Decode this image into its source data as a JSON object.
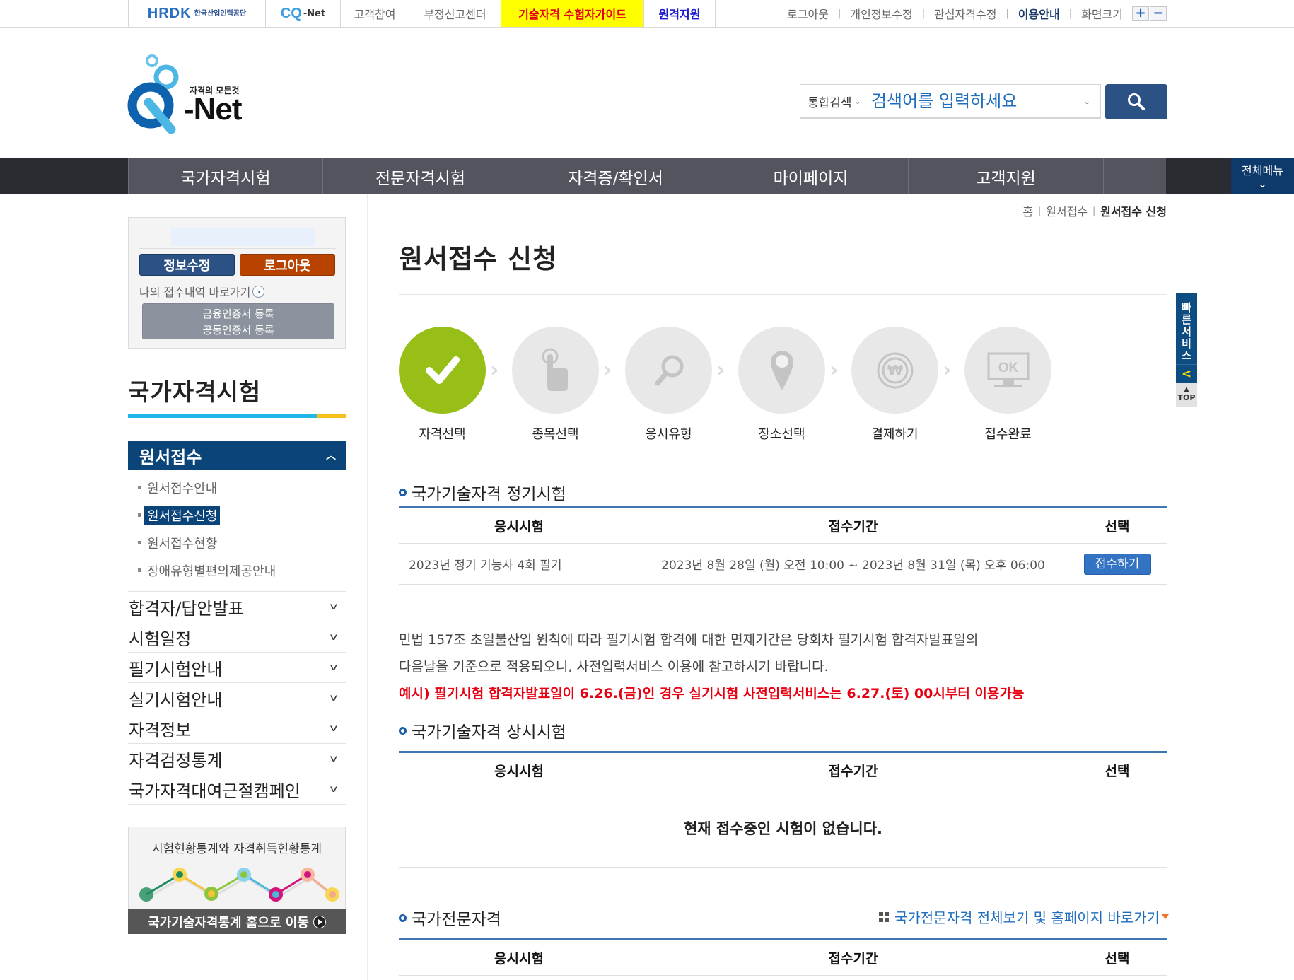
{
  "topbar": {
    "hrdk_logo": "HRDK",
    "hrdk_logo_kr": "한국산업인력공단",
    "cqnet_logo": "CQ",
    "cqnet_logo_suffix": "-Net",
    "links": [
      "고객참여",
      "부정신고센터"
    ],
    "highlight_link": "기술자격 수험자가이드",
    "remote_support": "원격지원",
    "util_links": [
      "로그아웃",
      "개인정보수정",
      "관심자격수정"
    ],
    "usage_guide": "이용안내",
    "screen_size_label": "화면크기",
    "zoom_in": "+",
    "zoom_out": "−"
  },
  "header": {
    "logo_slogan": "자격의 모든것",
    "logo_text": "-Net",
    "search": {
      "scope": "통합검색",
      "placeholder": "검색어를 입력하세요",
      "button_icon": "search-icon"
    }
  },
  "gnb": {
    "items": [
      "국가자격시험",
      "전문자격시험",
      "자격증/확인서",
      "마이페이지",
      "고객지원"
    ],
    "all_menu": "전체메뉴",
    "all_menu_icon": "chevron-down-icon"
  },
  "userbox": {
    "edit_button": "정보수정",
    "logout_button": "로그아웃",
    "my_history_link": "나의 접수내역 바로가기",
    "cert_links": [
      "금융인증서 등록",
      "공동인증서 등록"
    ]
  },
  "sidebar": {
    "title": "국가자격시험",
    "active_group": "원서접수",
    "sub_items": [
      {
        "label": "원서접수안내",
        "active": false
      },
      {
        "label": "원서접수신청",
        "active": true
      },
      {
        "label": "원서접수현황",
        "active": false
      },
      {
        "label": "장애유형별편의제공안내",
        "active": false
      }
    ],
    "menu": [
      "합격자/답안발표",
      "시험일정",
      "필기시험안내",
      "실기시험안내",
      "자격정보",
      "자격검정통계",
      "국가자격대여근절캠페인"
    ],
    "stat_banner": {
      "title": "시험현황통계와 자격취득현황통계",
      "footer": "국가기술자격통계 홈으로 이동"
    }
  },
  "breadcrumb": [
    "홈",
    "원서접수",
    "원서접수 신청"
  ],
  "page_title": "원서접수 신청",
  "steps": [
    {
      "label": "자격선택",
      "icon": "check-icon",
      "done": true
    },
    {
      "label": "종목선택",
      "icon": "hand-pointer-icon",
      "done": false
    },
    {
      "label": "응시유형",
      "icon": "magnifier-icon",
      "done": false
    },
    {
      "label": "장소선택",
      "icon": "map-pin-icon",
      "done": false
    },
    {
      "label": "결제하기",
      "icon": "won-coin-icon",
      "done": false
    },
    {
      "label": "접수완료",
      "icon": "monitor-ok-icon",
      "done": false
    }
  ],
  "sections": {
    "regular": {
      "title": "국가기술자격 정기시험",
      "headers": [
        "응시시험",
        "접수기간",
        "선택"
      ],
      "rows": [
        {
          "exam": "2023년 정기 기능사 4회 필기",
          "period": "2023년 8월 28일 (월) 오전 10:00 ~ 2023년 8월 31일 (목) 오후 06:00",
          "action": "접수하기"
        }
      ]
    },
    "notice": {
      "line1": "민법 157조 초일불산입 원칙에 따라 필기시험 합격에 대한 면제기간은 당회차 필기시험 합격자발표일의",
      "line2": "다음날을 기준으로 적용되오니, 사전입력서비스 이용에 참고하시기 바랍니다.",
      "example": "예시) 필기시험 합격자발표일이 6.26.(금)인 경우 실기시험 사전입력서비스는 6.27.(토) 00시부터 이용가능"
    },
    "ondemand": {
      "title": "국가기술자격 상시시험",
      "headers": [
        "응시시험",
        "접수기간",
        "선택"
      ],
      "empty": "현재 접수중인 시험이 없습니다."
    },
    "professional": {
      "title": "국가전문자격",
      "link": "국가전문자격 전체보기 및 홈페이지 바로가기",
      "headers": [
        "응시시험",
        "접수기간",
        "선택"
      ]
    }
  },
  "quick_service": {
    "label_chars": [
      "빠",
      "른",
      "서",
      "비",
      "스"
    ],
    "collapse": "<",
    "top": "TOP"
  },
  "colors": {
    "primary_navy": "#0b4478",
    "gnb_bg": "#52545e",
    "step_done": "#97bf17",
    "table_border": "#3e75b3",
    "alert_red": "#e60012",
    "logout_orange": "#b84300"
  }
}
